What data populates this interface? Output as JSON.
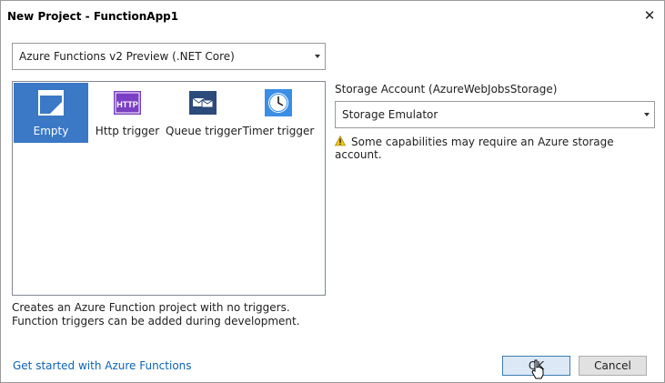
{
  "dialog": {
    "title": "New Project - FunctionApp1",
    "close_label": "✕"
  },
  "framework": {
    "selected": "Azure Functions v2 Preview (.NET Core)"
  },
  "templates": [
    {
      "label": "Empty",
      "icon": "empty-template-icon",
      "selected": true
    },
    {
      "label": "Http trigger",
      "icon": "http-trigger-icon",
      "selected": false
    },
    {
      "label": "Queue trigger",
      "icon": "queue-trigger-icon",
      "selected": false
    },
    {
      "label": "Timer trigger",
      "icon": "timer-trigger-icon",
      "selected": false
    }
  ],
  "description": "Creates an Azure Function project with no triggers.  Function triggers can be added during development.",
  "storage": {
    "label": "Storage Account (AzureWebJobsStorage)",
    "selected": "Storage Emulator",
    "warning": "Some capabilities may require an Azure storage account."
  },
  "footer": {
    "link": "Get started with Azure Functions",
    "ok_label": "OK",
    "cancel_label": "Cancel"
  },
  "colors": {
    "selection": "#3b78c6",
    "link": "#0e63b6",
    "http_purple": "#7a3fc2",
    "queue_navy": "#2c4a7a",
    "timer_blue": "#3a8ee6"
  }
}
